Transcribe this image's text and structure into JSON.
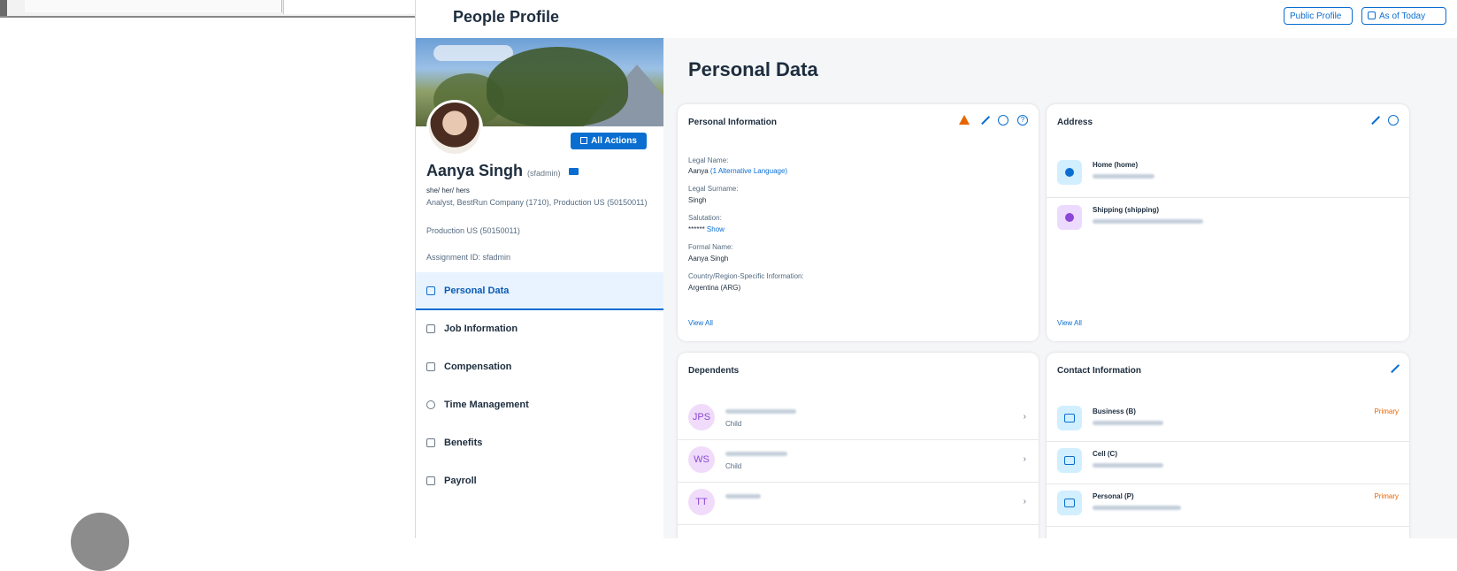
{
  "header": {
    "page_title": "People Profile",
    "public_profile_label": "Public Profile",
    "as_of_label": "As of Today"
  },
  "profile": {
    "all_actions_label": "All Actions",
    "name": "Aanya Singh",
    "username": "(sfadmin)",
    "pronouns": "she/ her/ hers",
    "job_line": "Analyst, BestRun Company (1710), Production US (50150011)",
    "location": "Production US (50150011)",
    "assignment": "Assignment ID:  sfadmin"
  },
  "nav": {
    "items": [
      {
        "label": "Personal Data",
        "icon": "person-icon"
      },
      {
        "label": "Job Information",
        "icon": "org-icon"
      },
      {
        "label": "Compensation",
        "icon": "doc-icon"
      },
      {
        "label": "Time Management",
        "icon": "clock-icon"
      },
      {
        "label": "Benefits",
        "icon": "benefits-icon"
      },
      {
        "label": "Payroll",
        "icon": "payroll-icon"
      }
    ]
  },
  "main": {
    "section_title": "Personal Data",
    "personal_info": {
      "title": "Personal Information",
      "fields": [
        {
          "label": "Legal Name:",
          "value": "Aanya",
          "link": "(1 Alternative Language)"
        },
        {
          "label": "Legal Surname:",
          "value": "Singh"
        },
        {
          "label": "Salutation:",
          "value": "******",
          "link": "Show"
        },
        {
          "label": "Formal Name:",
          "value": "Aanya Singh"
        },
        {
          "label": "Country/Region-Specific Information:",
          "value": "Argentina (ARG)"
        }
      ],
      "view_all": "View All"
    },
    "address": {
      "title": "Address",
      "items": [
        {
          "label": "Home (home)"
        },
        {
          "label": "Shipping (shipping)"
        }
      ],
      "view_all": "View All"
    },
    "dependents": {
      "title": "Dependents",
      "items": [
        {
          "initials": "JPS",
          "relation": "Child"
        },
        {
          "initials": "WS",
          "relation": "Child"
        },
        {
          "initials": "TT",
          "relation": ""
        }
      ]
    },
    "contact": {
      "title": "Contact Information",
      "items": [
        {
          "label": "Business (B)",
          "badge": "Primary"
        },
        {
          "label": "Cell (C)",
          "badge": ""
        },
        {
          "label": "Personal (P)",
          "badge": "Primary"
        }
      ]
    }
  },
  "colors": {
    "accent": "#0a6ed1",
    "warning": "#e76500",
    "background": "#f5f6f7"
  }
}
